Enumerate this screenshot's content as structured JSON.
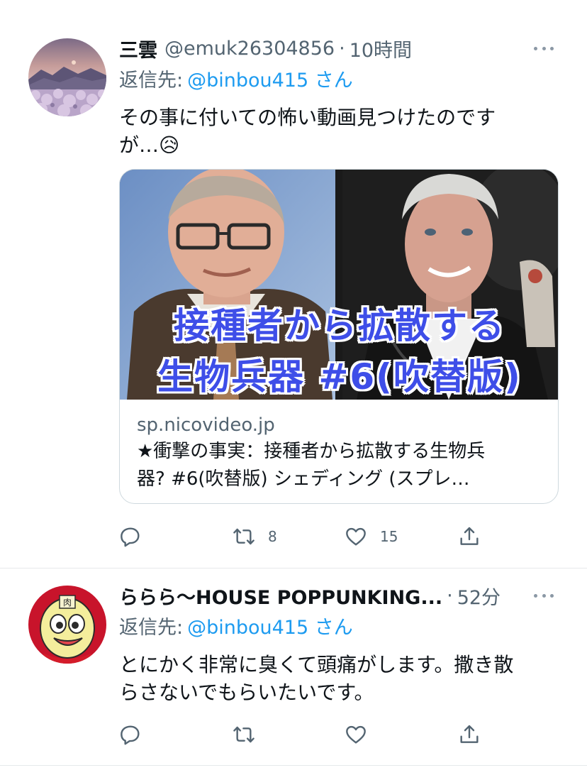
{
  "tweets": [
    {
      "name": "三雲",
      "handle": "@emuk26304856",
      "dot": "·",
      "time": "10時間",
      "reply_prefix": "返信先:",
      "reply_to": "@binbou415 さん",
      "text_line1": "その事に付いての怖い動画見つけたのです",
      "text_line2": "が…😥",
      "card": {
        "overlay_line1": "接種者から拡散する",
        "overlay_line2": "生物兵器 #6(吹替版)",
        "domain": "sp.nicovideo.jp",
        "title_line1": "★衝撃の事実：接種者から拡散する生物兵",
        "title_line2": "器? #6(吹替版) シェディング (スプレ…"
      },
      "actions": {
        "reply_count": "",
        "retweet_count": "8",
        "like_count": "15"
      },
      "avatar_icon": "landscape-sakura-avatar"
    },
    {
      "name": "ららら〜HOUSE POPPUNKING...",
      "dot": "·",
      "time": "52分",
      "reply_prefix": "返信先:",
      "reply_to": "@binbou415 さん",
      "text_line1": "とにかく非常に臭くて頭痛がします。撒き散",
      "text_line2": "らさないでもらいたいです。",
      "actions": {
        "reply_count": "",
        "retweet_count": "",
        "like_count": ""
      },
      "avatar_icon": "cartoon-face-avatar"
    }
  ],
  "colors": {
    "link": "#1d9bf0",
    "secondary_text": "#536471",
    "primary_text": "#0f1419",
    "overlay_text": "#3e4ee8"
  },
  "icons": [
    "more-icon",
    "reply-icon",
    "retweet-icon",
    "like-icon",
    "share-icon"
  ]
}
